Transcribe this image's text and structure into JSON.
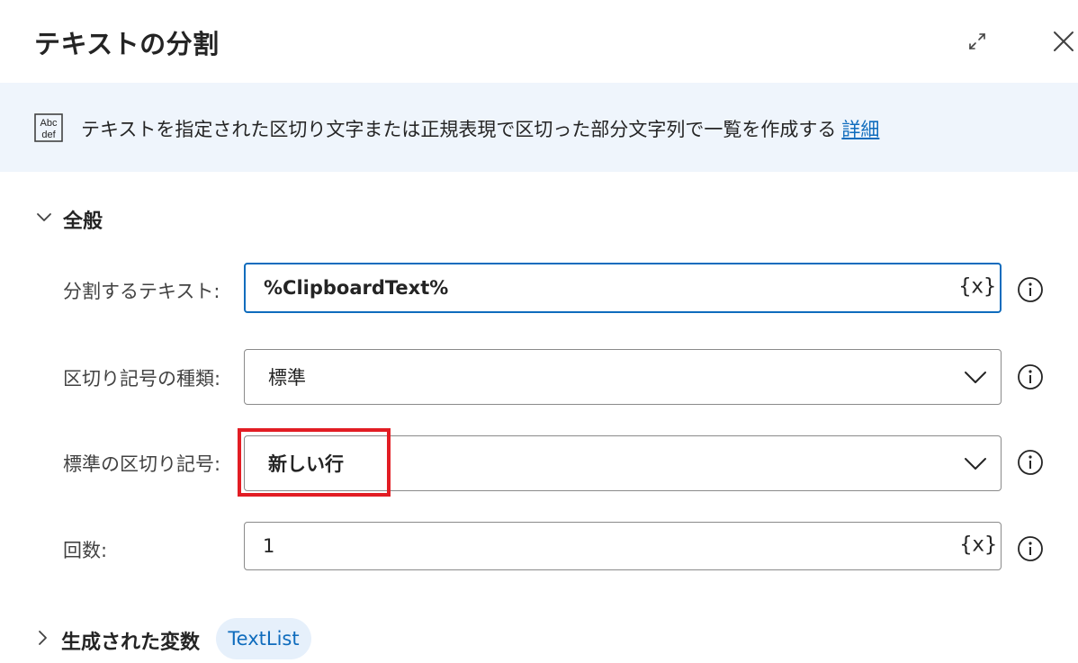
{
  "dialog": {
    "title": "テキストの分割"
  },
  "banner": {
    "icon": "abc-def-icon",
    "description": "テキストを指定された区切り文字または正規表現で区切った部分文字列で一覧を作成する",
    "link": "詳細"
  },
  "general": {
    "title": "全般",
    "fields": {
      "text": {
        "label": "分割するテキスト:",
        "value": "%ClipboardText%",
        "var_button": "{x}"
      },
      "separator_type": {
        "label": "区切り記号の種類:",
        "value": "標準"
      },
      "standard_separator": {
        "label": "標準の区切り記号:",
        "value": "新しい行"
      },
      "times": {
        "label": "回数:",
        "value": "1",
        "var_button": "{x}"
      }
    }
  },
  "produced_variables": {
    "title": "生成された変数",
    "chip": "TextList"
  },
  "colors": {
    "accent": "#0f6cbd",
    "highlight": "#e21d24",
    "banner_bg": "#eff5fc",
    "chip_bg": "#e6f0fb"
  }
}
